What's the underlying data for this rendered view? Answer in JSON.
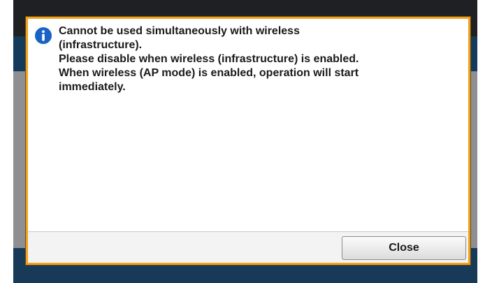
{
  "dialog": {
    "icon": "info-icon",
    "message_lines": [
      "Cannot be used simultaneously with wireless",
      "(infrastructure).",
      "Please disable when wireless (infrastructure) is enabled.",
      "When wireless (AP mode) is enabled, operation will start",
      "immediately."
    ],
    "close_label": "Close"
  },
  "colors": {
    "dialog_border": "#f0a21e",
    "info_icon": "#1a63c6",
    "background_dark": "#1e2024",
    "background_band": "#143b5c",
    "background_panel": "#8d8f92"
  }
}
